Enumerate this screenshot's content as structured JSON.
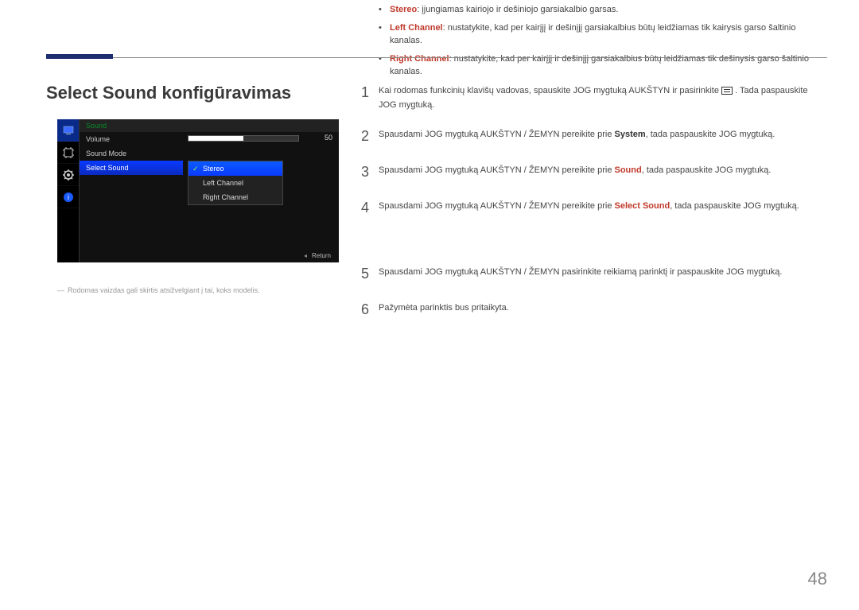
{
  "page": {
    "number": "48",
    "title": "Select Sound konfigūravimas"
  },
  "osd": {
    "header": "Sound",
    "rows": {
      "volume": "Volume",
      "sound_mode": "Sound Mode",
      "select_sound": "Select Sound"
    },
    "slider_value": "50",
    "options": {
      "stereo": "Stereo",
      "left": "Left Channel",
      "right": "Right Channel"
    },
    "return": "Return",
    "note": "Rodomas vaizdas gali skirtis atsižvelgiant į tai, koks modelis."
  },
  "steps": {
    "s1a": "Kai rodomas funkcinių klavišų vadovas, spauskite JOG mygtuką AUKŠTYN ir pasirinkite ",
    "s1b": ". Tada paspauskite JOG mygtuką.",
    "s2a": "Spausdami JOG mygtuką AUKŠTYN / ŽEMYN pereikite prie ",
    "s2_sys": "System",
    "s2b": ", tada paspauskite JOG mygtuką.",
    "s3a": "Spausdami JOG mygtuką AUKŠTYN / ŽEMYN pereikite prie ",
    "s3_sound": "Sound",
    "s3b": ", tada paspauskite JOG mygtuką.",
    "s4a": "Spausdami JOG mygtuką AUKŠTYN / ŽEMYN pereikite prie ",
    "s4_sel": "Select Sound",
    "s4b": ", tada paspauskite JOG mygtuką.",
    "s5": "Spausdami JOG mygtuką AUKŠTYN / ŽEMYN pasirinkite reikiamą parinktį ir paspauskite JOG mygtuką.",
    "s6": "Pažymėta parinktis bus pritaikyta."
  },
  "bullets": {
    "stereo_label": "Stereo",
    "stereo_text": ": įjungiamas kairiojo ir dešiniojo garsiakalbio garsas.",
    "left_label": "Left Channel",
    "left_text": ": nustatykite, kad per kairįjį ir dešinįjį garsiakalbius būtų leidžiamas tik kairysis garso šaltinio kanalas.",
    "right_label": "Right Channel",
    "right_text": ": nustatykite, kad per kairįjį ir dešinįjį garsiakalbius būtų leidžiamas tik dešinysis garso šaltinio kanalas."
  }
}
